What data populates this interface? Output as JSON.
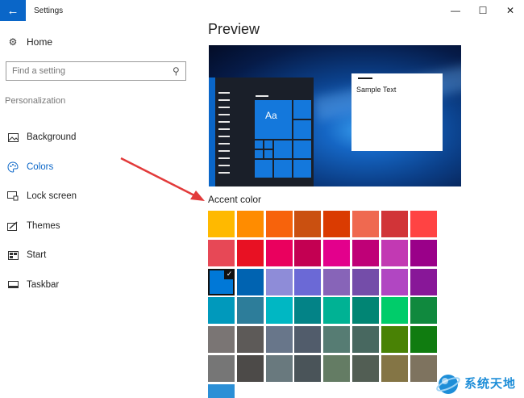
{
  "window": {
    "title": "Settings",
    "back_glyph": "←",
    "minimize_glyph": "—",
    "maximize_glyph": "☐",
    "close_glyph": "✕"
  },
  "sidebar": {
    "home_label": "Home",
    "search": {
      "placeholder": "Find a setting",
      "value": ""
    },
    "section_label": "Personalization",
    "items": [
      {
        "label": "Background",
        "icon": "image-icon",
        "active": false
      },
      {
        "label": "Colors",
        "icon": "palette-icon",
        "active": true
      },
      {
        "label": "Lock screen",
        "icon": "lock-screen-icon",
        "active": false
      },
      {
        "label": "Themes",
        "icon": "themes-icon",
        "active": false
      },
      {
        "label": "Start",
        "icon": "start-icon",
        "active": false
      },
      {
        "label": "Taskbar",
        "icon": "taskbar-icon",
        "active": false
      }
    ]
  },
  "main": {
    "preview_title": "Preview",
    "preview": {
      "tile_text": "Aa",
      "sample_text": "Sample Text"
    },
    "accent_label": "Accent color",
    "selected_swatch": 16,
    "swatches": [
      "#ffb900",
      "#ff8c00",
      "#f7630c",
      "#ca5010",
      "#da3b01",
      "#ef6950",
      "#d13438",
      "#ff4343",
      "#e74856",
      "#e81123",
      "#ea005e",
      "#c30052",
      "#e3008c",
      "#bf0077",
      "#c239b3",
      "#9a0089",
      "#0078d7",
      "#0063b1",
      "#8e8cd8",
      "#6b69d6",
      "#8764b8",
      "#744da9",
      "#b146c2",
      "#881798",
      "#0099bc",
      "#2d7d9a",
      "#00b7c3",
      "#038387",
      "#00b294",
      "#018574",
      "#00cc6a",
      "#10893e",
      "#7a7574",
      "#5d5a58",
      "#68768a",
      "#515c6b",
      "#567c73",
      "#486860",
      "#498205",
      "#107c10",
      "#767676",
      "#4c4a48",
      "#69797e",
      "#4a5459",
      "#647c64",
      "#525e54",
      "#847545",
      "#7e735f",
      "#2b8fd6"
    ]
  },
  "watermark": {
    "text": "系统天地"
  }
}
